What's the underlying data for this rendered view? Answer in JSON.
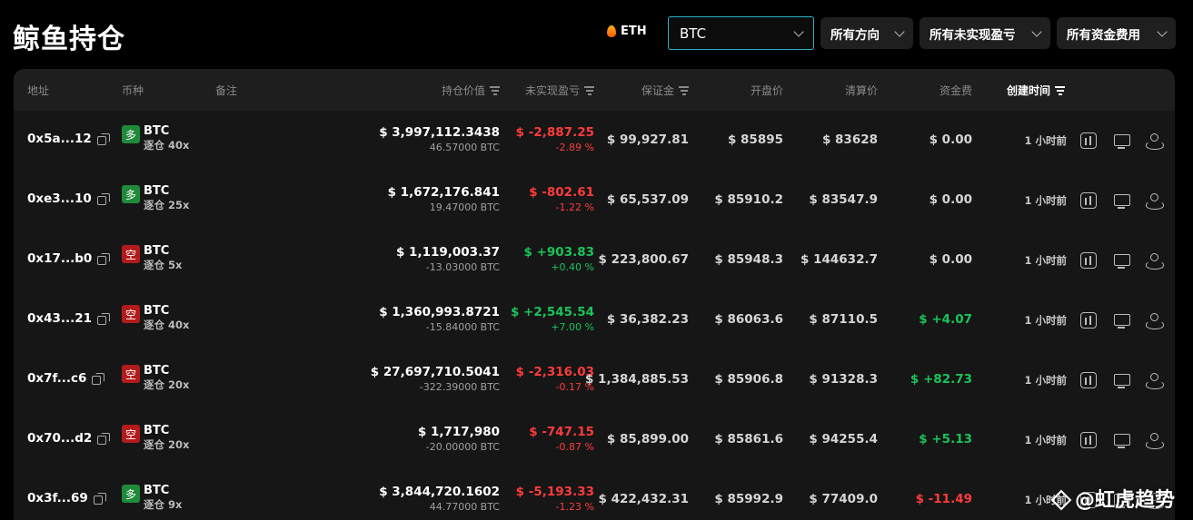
{
  "page": {
    "title": "鲸鱼持仓"
  },
  "quick_coin": {
    "label": "ETH",
    "icon": "flame-icon"
  },
  "coin_select": {
    "value": "BTC"
  },
  "filters": [
    {
      "label": "所有方向"
    },
    {
      "label": "所有未实现盈亏"
    },
    {
      "label": "所有资金费用"
    }
  ],
  "table": {
    "headers": {
      "address": "地址",
      "coin": "币种",
      "note": "备注",
      "value": "持仓价值",
      "pnl": "未实现盈亏",
      "margin": "保证金",
      "open": "开盘价",
      "liq": "清算价",
      "funding": "资金费",
      "created": "创建时间"
    },
    "rows": [
      {
        "address": "0x5a...12",
        "side": "多",
        "side_type": "long",
        "coin": "BTC",
        "leverage": "逐仓 40x",
        "value": "$ 3,997,112.3438",
        "size": "46.57000 BTC",
        "pnl": "$ -2,887.25",
        "pnl_pct": "-2.89 %",
        "pnl_sign": "neg",
        "margin": "$ 99,927.81",
        "open": "$ 85895",
        "liq": "$ 83628",
        "funding": "$ 0.00",
        "funding_sign": "zero",
        "time": "1 小时前"
      },
      {
        "address": "0xe3...10",
        "side": "多",
        "side_type": "long",
        "coin": "BTC",
        "leverage": "逐仓 25x",
        "value": "$ 1,672,176.841",
        "size": "19.47000 BTC",
        "pnl": "$ -802.61",
        "pnl_pct": "-1.22 %",
        "pnl_sign": "neg",
        "margin": "$ 65,537.09",
        "open": "$ 85910.2",
        "liq": "$ 83547.9",
        "funding": "$ 0.00",
        "funding_sign": "zero",
        "time": "1 小时前"
      },
      {
        "address": "0x17...b0",
        "side": "空",
        "side_type": "short",
        "coin": "BTC",
        "leverage": "逐仓 5x",
        "value": "$ 1,119,003.37",
        "size": "-13.03000 BTC",
        "pnl": "$ +903.83",
        "pnl_pct": "+0.40 %",
        "pnl_sign": "pos",
        "margin": "$ 223,800.67",
        "open": "$ 85948.3",
        "liq": "$ 144632.7",
        "funding": "$ 0.00",
        "funding_sign": "zero",
        "time": "1 小时前"
      },
      {
        "address": "0x43...21",
        "side": "空",
        "side_type": "short",
        "coin": "BTC",
        "leverage": "逐仓 40x",
        "value": "$ 1,360,993.8721",
        "size": "-15.84000 BTC",
        "pnl": "$ +2,545.54",
        "pnl_pct": "+7.00 %",
        "pnl_sign": "pos",
        "margin": "$ 36,382.23",
        "open": "$ 86063.6",
        "liq": "$ 87110.5",
        "funding": "$ +4.07",
        "funding_sign": "pos",
        "time": "1 小时前"
      },
      {
        "address": "0x7f...c6",
        "side": "空",
        "side_type": "short",
        "coin": "BTC",
        "leverage": "逐仓 20x",
        "value": "$ 27,697,710.5041",
        "size": "-322.39000 BTC",
        "pnl": "$ -2,316.03",
        "pnl_pct": "-0.17 %",
        "pnl_sign": "neg",
        "margin": "$ 1,384,885.53",
        "open": "$ 85906.8",
        "liq": "$ 91328.3",
        "funding": "$ +82.73",
        "funding_sign": "pos",
        "time": "1 小时前"
      },
      {
        "address": "0x70...d2",
        "side": "空",
        "side_type": "short",
        "coin": "BTC",
        "leverage": "逐仓 20x",
        "value": "$ 1,717,980",
        "size": "-20.00000 BTC",
        "pnl": "$ -747.15",
        "pnl_pct": "-0.87 %",
        "pnl_sign": "neg",
        "margin": "$ 85,899.00",
        "open": "$ 85861.6",
        "liq": "$ 94255.4",
        "funding": "$ +5.13",
        "funding_sign": "pos",
        "time": "1 小时前"
      },
      {
        "address": "0x3f...69",
        "side": "多",
        "side_type": "long",
        "coin": "BTC",
        "leverage": "逐仓 9x",
        "value": "$ 3,844,720.1602",
        "size": "44.77000 BTC",
        "pnl": "$ -5,193.33",
        "pnl_pct": "-1.23 %",
        "pnl_sign": "neg",
        "margin": "$ 422,432.31",
        "open": "$ 85992.9",
        "liq": "$ 77409.0",
        "funding": "$ -11.49",
        "funding_sign": "neg",
        "time": "1 小时前"
      }
    ],
    "row_action_icons": [
      "bar-chart-icon",
      "monitor-icon",
      "network-icon"
    ]
  },
  "watermark": {
    "text": "@虹虎趋势"
  },
  "colors": {
    "accent": "#2bb1c6",
    "positive": "#19c45a",
    "negative": "#ff3b3b",
    "long_badge": "#1f8a3a",
    "short_badge": "#b21b1b"
  }
}
